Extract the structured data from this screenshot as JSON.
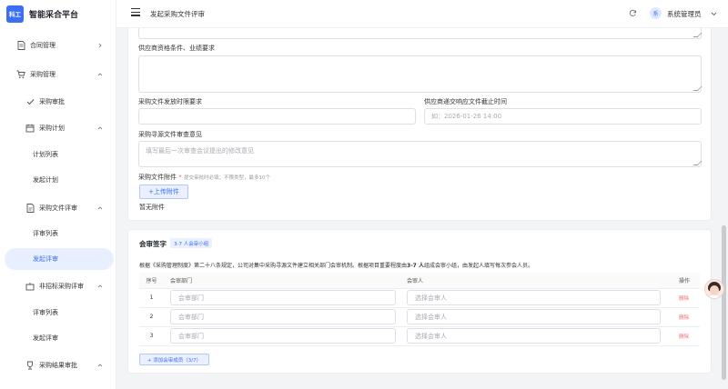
{
  "app": {
    "logo_text": "科工",
    "name": "智能采合平台"
  },
  "sidebar": {
    "items": [
      {
        "label": "合同管理",
        "icon": "document-icon"
      },
      {
        "label": "采购管理",
        "icon": "cart-icon"
      },
      {
        "label": "采购审批",
        "icon": "check-icon"
      },
      {
        "label": "采购计划",
        "icon": "calendar-icon"
      },
      {
        "label": "计划列表"
      },
      {
        "label": "发起计划"
      },
      {
        "label": "采购文件评审",
        "icon": "file-icon"
      },
      {
        "label": "评审列表"
      },
      {
        "label": "发起评审"
      },
      {
        "label": "非招标采购评审",
        "icon": "box-icon"
      },
      {
        "label": "评审列表"
      },
      {
        "label": "发起评审"
      },
      {
        "label": "采购结果审批",
        "icon": "trophy-icon"
      }
    ]
  },
  "header": {
    "title": "发起采购文件评审",
    "user_avatar": "系",
    "user_name": "系统管理员"
  },
  "form": {
    "supplier_req_label": "供应商资格条件、业绩要求",
    "issue_time_label": "采购文件发放时限要求",
    "deadline_label": "供应商递交响应文件截止时间",
    "deadline_placeholder": "如：2026-01-26 14:00",
    "review_opinion_label": "采购寻源文件审查意见",
    "review_opinion_placeholder": "填写最后一次审查会议提出的修改意见",
    "attachment_label": "采购文件附件",
    "attachment_required_mark": "*",
    "attachment_hint": "提交审批时必填；不限类型，最多10个",
    "upload_button": "+上传附件",
    "no_attachment": "暂无附件"
  },
  "review_panel": {
    "title": "会审签字",
    "tag": "3-7 人会审小组",
    "description_pre": "根据《采购管理制度》第二十八条规定，公司对集中采购寻源文件建立相关部门会审机制。根据项目重要程度由",
    "description_bold": "3-7 人",
    "description_post": "组成会审小组，由发起人填写每次参会人员。",
    "columns": [
      "序号",
      "会审部门",
      "会审人",
      "操作"
    ],
    "rows": [
      {
        "index": "1",
        "dept_placeholder": "会审部门",
        "user_placeholder": "选择会审人",
        "action": "删除"
      },
      {
        "index": "2",
        "dept_placeholder": "会审部门",
        "user_placeholder": "选择会审人",
        "action": "删除"
      },
      {
        "index": "3",
        "dept_placeholder": "会审部门",
        "user_placeholder": "选择会审人",
        "action": "删除"
      }
    ],
    "add_button": "+ 添加会审成员（3/7）"
  },
  "colors": {
    "accent": "#3b6ef5",
    "danger": "#f56c6c",
    "active_bg": "#e8efff"
  }
}
